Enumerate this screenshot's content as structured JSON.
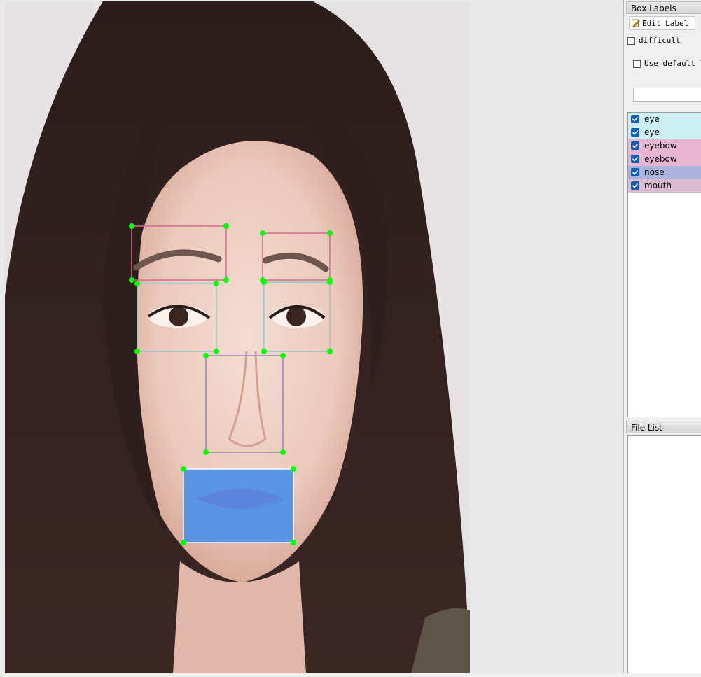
{
  "dock": {
    "box_labels_title": "Box Labels",
    "edit_label_button": "Edit Label",
    "difficult_label": "difficult",
    "use_default_label": "Use default l",
    "label_input_value": "",
    "file_list_title": "File List"
  },
  "labels": [
    {
      "text": "eye",
      "checked": true,
      "color": "#cdeff2"
    },
    {
      "text": "eye",
      "checked": true,
      "color": "#cdeff2"
    },
    {
      "text": "eyebow",
      "checked": true,
      "color": "#e8b6d3"
    },
    {
      "text": "eyebow",
      "checked": true,
      "color": "#e8b6d3"
    },
    {
      "text": "nose",
      "checked": true,
      "color": "#a9b3db"
    },
    {
      "text": "mouth",
      "checked": true,
      "color": "#d9bccf"
    }
  ],
  "annotation_colors": {
    "eye": "#8fc7c7",
    "eyebow": "#d76b8f",
    "nose": "#8f85c0",
    "mouth": "#4a8fe8",
    "vertex": "#00ff00"
  },
  "file_list": []
}
